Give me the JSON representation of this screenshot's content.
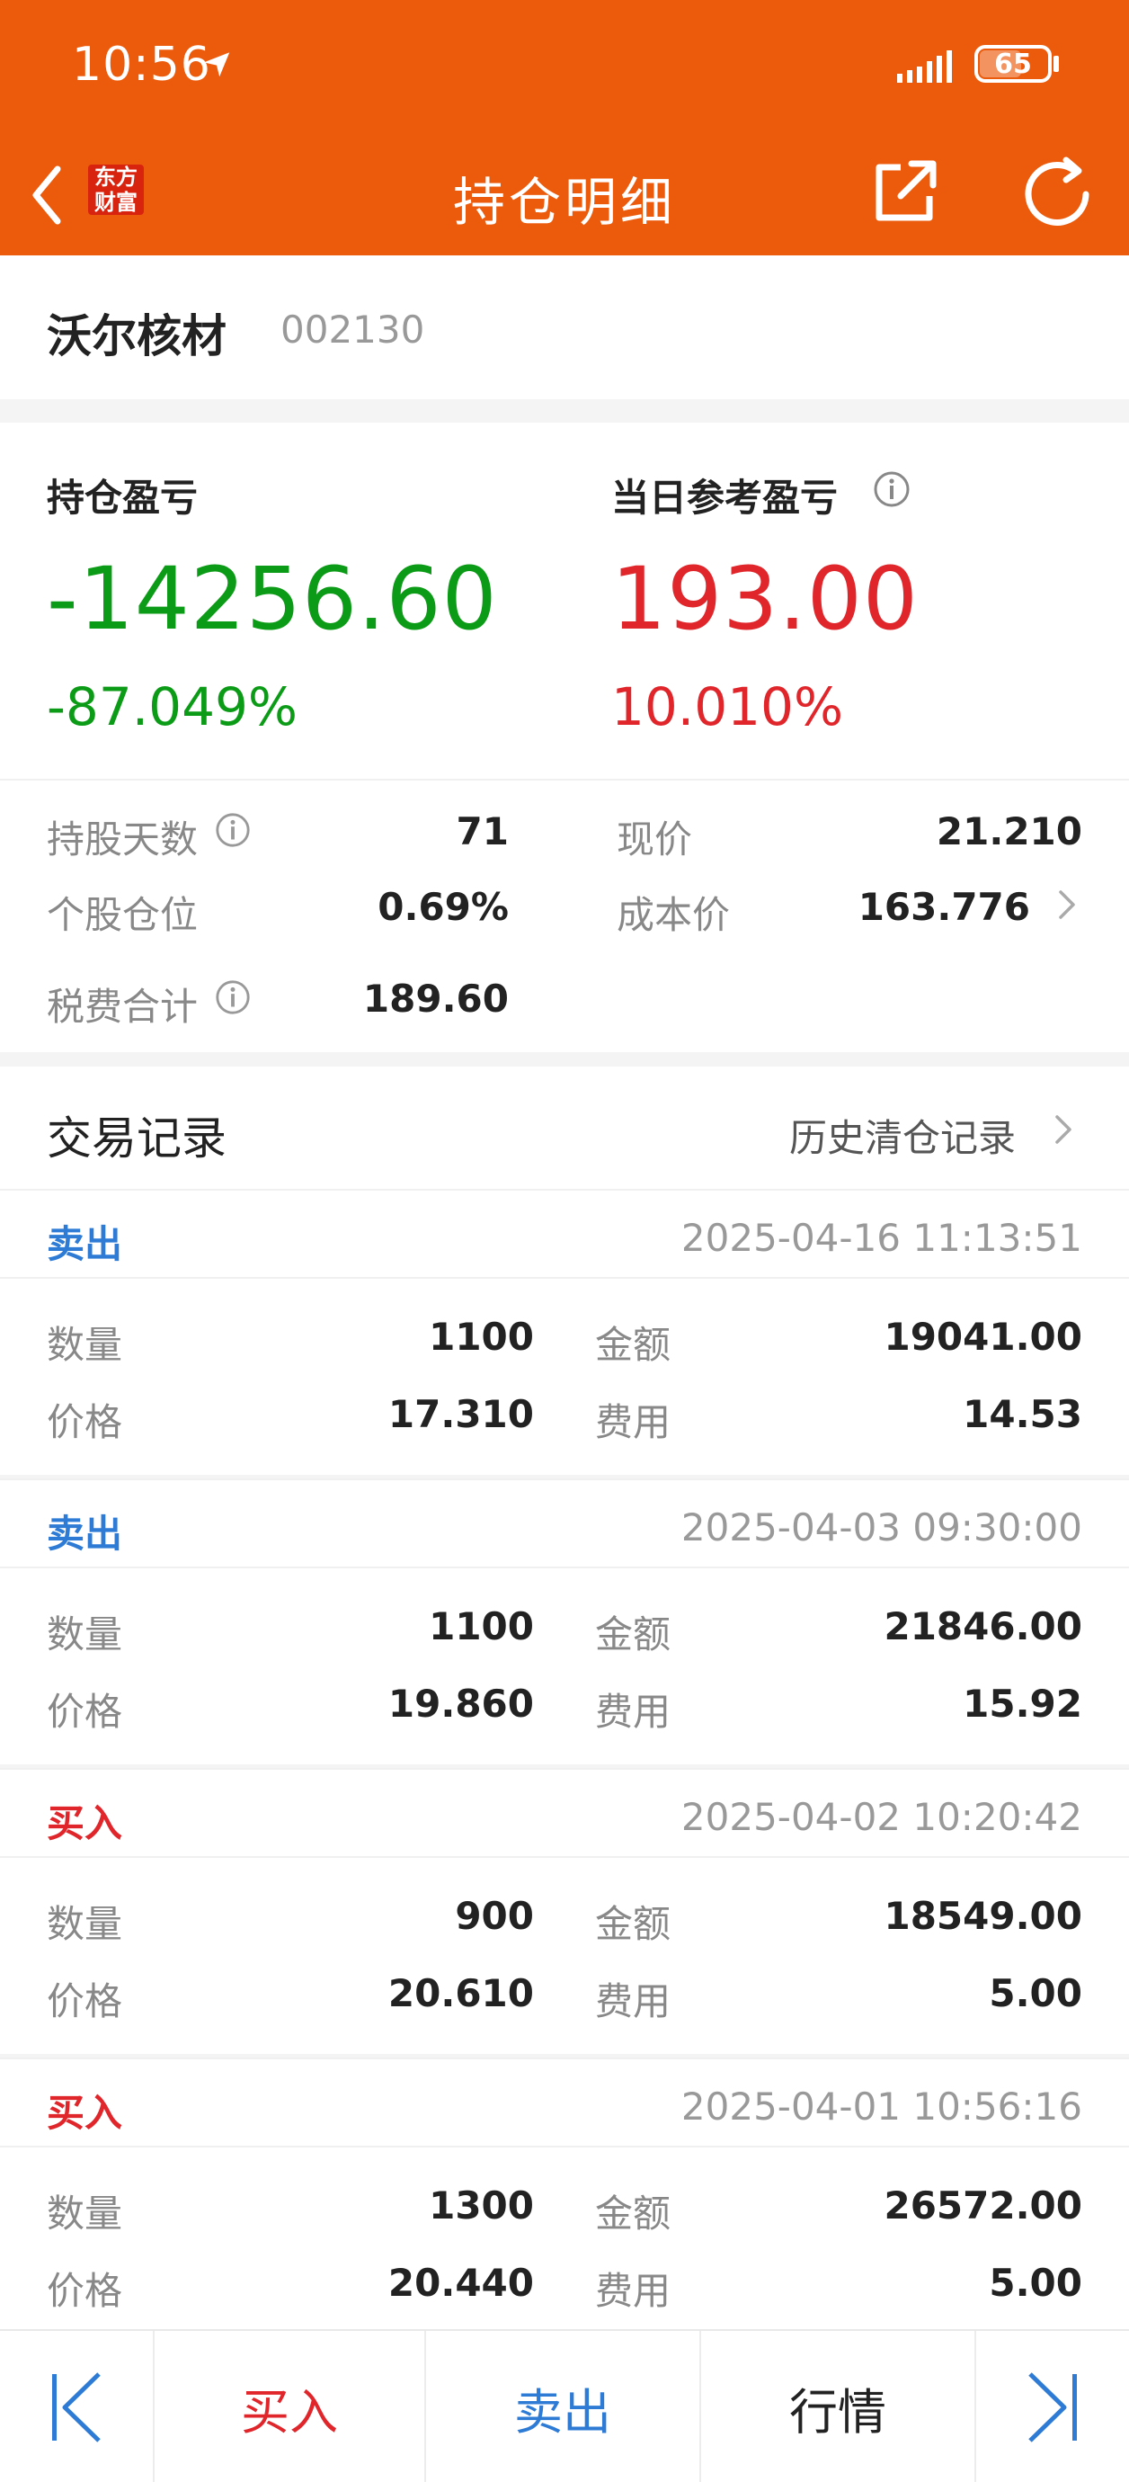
{
  "status_bar": {
    "time": "10:56",
    "battery": "65"
  },
  "nav": {
    "title": "持仓明细",
    "logo_line1": "东方",
    "logo_line2": "财富",
    "back_icon": "chevron-left-icon",
    "share_icon": "share-icon",
    "refresh_icon": "refresh-icon"
  },
  "stock": {
    "name": "沃尔核材",
    "code": "002130"
  },
  "pnl": {
    "holding_label": "持仓盈亏",
    "holding_value": "-14256.60",
    "holding_pct": "-87.049%",
    "daily_label": "当日参考盈亏",
    "daily_value": "193.00",
    "daily_pct": "10.010%"
  },
  "details": {
    "days_label": "持股天数",
    "days_value": "71",
    "price_label": "现价",
    "price_value": "21.210",
    "position_label": "个股仓位",
    "position_value": "0.69%",
    "cost_label": "成本价",
    "cost_value": "163.776",
    "fee_label": "税费合计",
    "fee_value": "189.60"
  },
  "records": {
    "title": "交易记录",
    "history_link": "历史清仓记录",
    "labels": {
      "qty": "数量",
      "amount": "金额",
      "price": "价格",
      "fee": "费用"
    },
    "items": [
      {
        "type": "卖出",
        "time": "2025-04-16 11:13:51",
        "qty": "1100",
        "amount": "19041.00",
        "price": "17.310",
        "fee": "14.53"
      },
      {
        "type": "卖出",
        "time": "2025-04-03 09:30:00",
        "qty": "1100",
        "amount": "21846.00",
        "price": "19.860",
        "fee": "15.92"
      },
      {
        "type": "买入",
        "time": "2025-04-02 10:20:42",
        "qty": "900",
        "amount": "18549.00",
        "price": "20.610",
        "fee": "5.00"
      },
      {
        "type": "买入",
        "time": "2025-04-01 10:56:16",
        "qty": "1300",
        "amount": "26572.00",
        "price": "20.440",
        "fee": "5.00"
      }
    ]
  },
  "bottom_bar": {
    "buy": "买入",
    "sell": "卖出",
    "market": "行情"
  },
  "colors": {
    "brand": "#ec5a0b",
    "loss_green": "#0c9b16",
    "gain_red": "#e0262b",
    "sell_blue": "#2e7bd6"
  }
}
